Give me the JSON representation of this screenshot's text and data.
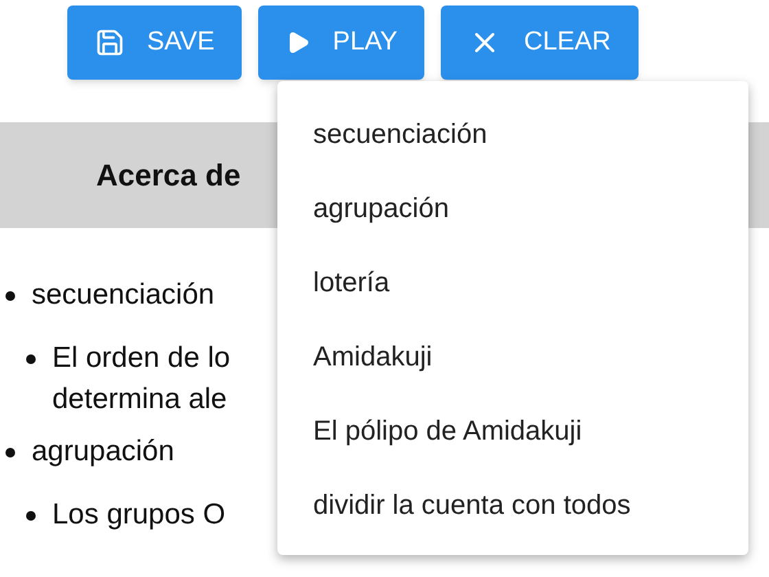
{
  "toolbar": {
    "buttons": [
      {
        "kind": "save",
        "label": "SAVE"
      },
      {
        "kind": "play",
        "label": "PLAY"
      },
      {
        "kind": "clear",
        "label": "CLEAR"
      }
    ]
  },
  "header": {
    "title": "Acerca de"
  },
  "list": [
    {
      "text": "secuenciación",
      "children": [
        {
          "lines": [
            "El orden de lo",
            "determina ale"
          ]
        }
      ]
    },
    {
      "text": "agrupación",
      "children": [
        {
          "lines": [
            "Los grupos O"
          ]
        }
      ]
    }
  ],
  "menu": {
    "items": [
      "secuenciación",
      "agrupación",
      "lotería",
      "Amidakuji",
      "El pólipo de Amidakuji",
      "dividir la cuenta con todos"
    ]
  }
}
